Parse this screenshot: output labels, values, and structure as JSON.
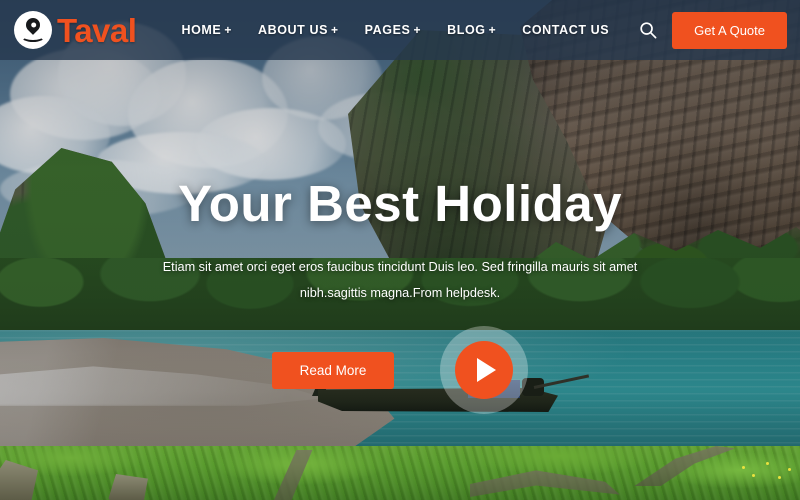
{
  "brand": {
    "name": "Taval",
    "logo_icon": "map-pin-location-icon",
    "accent_color": "#f0511f",
    "header_bg_color": "#26384e"
  },
  "nav": {
    "items": [
      {
        "label": "HOME",
        "has_dropdown": true,
        "plus": "+"
      },
      {
        "label": "ABOUT US",
        "has_dropdown": true,
        "plus": "+"
      },
      {
        "label": "PAGES",
        "has_dropdown": true,
        "plus": "+"
      },
      {
        "label": "BLOG",
        "has_dropdown": true,
        "plus": "+"
      },
      {
        "label": "CONTACT US",
        "has_dropdown": false,
        "plus": ""
      }
    ]
  },
  "header_actions": {
    "search_icon": "search-icon",
    "quote_label": "Get A Quote"
  },
  "hero": {
    "title": "Your Best Holiday",
    "subtitle_line1": "Etiam sit amet orci eget eros faucibus tincidunt Duis leo. Sed fringilla mauris sit",
    "subtitle_line2": "amet nibh.sagittis magna.From helpdesk.",
    "read_more_label": "Read More",
    "play_icon": "play-button-icon"
  }
}
